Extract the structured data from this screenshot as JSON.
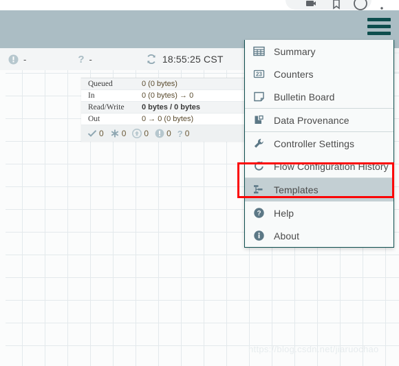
{
  "browser": {
    "icons": [
      "cast-icon",
      "bookmark-icon",
      "profile-icon",
      "menu-dots-icon"
    ]
  },
  "header": {
    "menu_button_label": "global-menu",
    "background_color": "#abbdc4",
    "hamburger_color": "#0d4d4d"
  },
  "status_bar": {
    "bulletin_icon": "alert-icon",
    "bulletin_value": "-",
    "unknown_icon": "question-icon",
    "unknown_value": "-",
    "refresh_icon": "refresh-icon",
    "last_refreshed": "18:55:25 CST"
  },
  "processor_stats": {
    "rows": [
      {
        "label": "Queued",
        "value": "0 (0 bytes)",
        "bold_value": false,
        "striped": true
      },
      {
        "label": "In",
        "value": "0 (0 bytes) → 0",
        "bold_value": false,
        "striped": false
      },
      {
        "label": "Read/Write",
        "value": "0 bytes / 0 bytes",
        "bold_value": true,
        "striped": true
      },
      {
        "label": "Out",
        "value": "0 → 0 (0 bytes)",
        "bold_value": false,
        "striped": false
      }
    ],
    "footer_counts": [
      {
        "icon": "check-icon",
        "count": "0"
      },
      {
        "icon": "asterisk-icon",
        "count": "0"
      },
      {
        "icon": "upload-icon",
        "count": "0"
      },
      {
        "icon": "warning-icon",
        "count": "0"
      },
      {
        "icon": "question-icon",
        "count": "0"
      }
    ]
  },
  "global_menu": {
    "groups": [
      {
        "items": [
          {
            "label": "Summary",
            "icon": "table-icon",
            "selected": false
          },
          {
            "label": "Counters",
            "icon": "counters-23-icon",
            "selected": false
          },
          {
            "label": "Bulletin Board",
            "icon": "note-icon",
            "selected": false
          }
        ]
      },
      {
        "items": [
          {
            "label": "Data Provenance",
            "icon": "provenance-icon",
            "selected": false
          }
        ]
      },
      {
        "items": [
          {
            "label": "Controller Settings",
            "icon": "wrench-icon",
            "selected": false
          },
          {
            "label": "Flow Configuration History",
            "icon": "history-icon",
            "selected": false
          }
        ]
      },
      {
        "items": [
          {
            "label": "Templates",
            "icon": "template-icon",
            "selected": true
          }
        ]
      },
      {
        "items": [
          {
            "label": "Help",
            "icon": "help-icon",
            "selected": false
          },
          {
            "label": "About",
            "icon": "info-icon",
            "selected": false
          }
        ]
      }
    ],
    "highlight_color": "#fb0303",
    "selected_item_background": "#c3cfd3",
    "border_color": "#0d4d4d"
  },
  "watermark": {
    "text": "https://blog.csdn.net/jiaruochao"
  }
}
